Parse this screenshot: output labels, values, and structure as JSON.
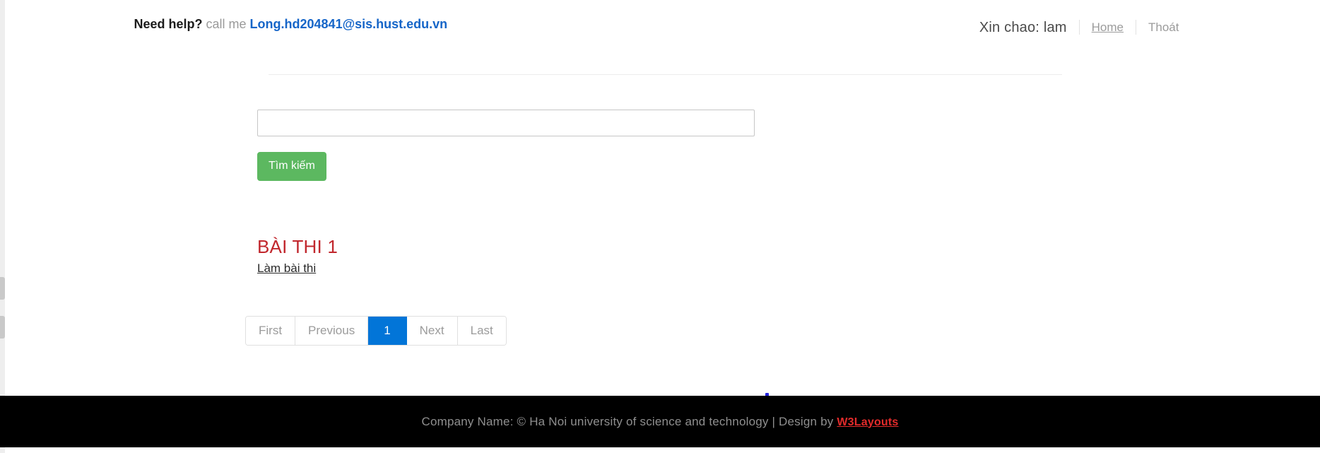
{
  "header": {
    "help_strong": "Need help?",
    "help_middle": " call me ",
    "help_email": "Long.hd204841@sis.hust.edu.vn",
    "greeting": "Xin chao: lam",
    "home_link": "Home",
    "logout_link": "Thoát"
  },
  "search": {
    "value": "",
    "placeholder": "",
    "button_label": "Tìm kiếm"
  },
  "exams": [
    {
      "title": "BÀI THI 1",
      "action_label": "Làm bài thi"
    }
  ],
  "pagination": {
    "first": "First",
    "previous": "Previous",
    "current": "1",
    "next": "Next",
    "last": "Last"
  },
  "footer": {
    "text": "Company Name: © Ha Noi university of science and technology | Design by ",
    "link": "W3Layouts"
  },
  "colors": {
    "accent_green": "#5cb860",
    "accent_blue": "#0275d8",
    "exam_red": "#c1272d",
    "link_blue": "#1565c8",
    "footer_link_red": "#e32b2b",
    "footer_bg": "#000000"
  }
}
